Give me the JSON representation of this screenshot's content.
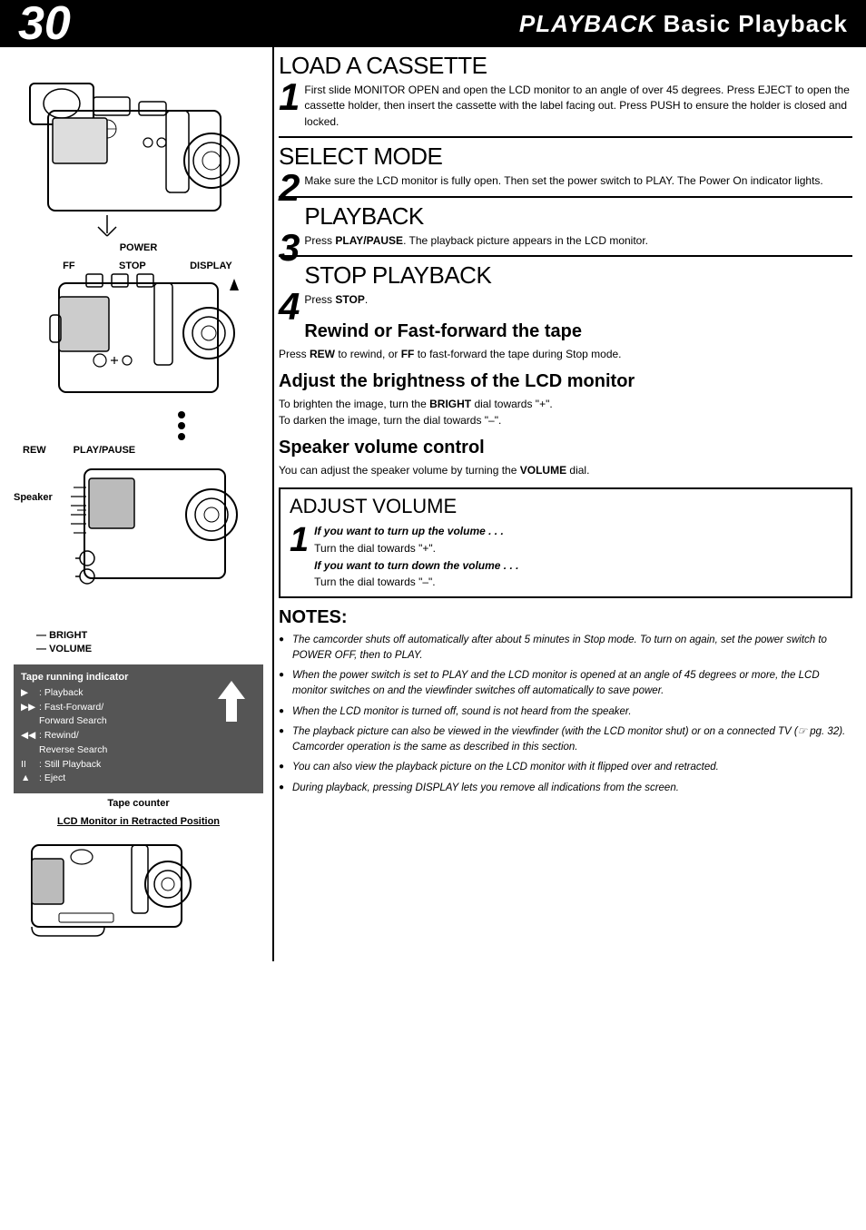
{
  "header": {
    "page_number": "30",
    "title_italic": "PLAYBACK",
    "title_normal": " Basic Playback"
  },
  "left": {
    "power_label": "POWER",
    "ff_label": "FF",
    "stop_label": "STOP",
    "display_label": "DISPLAY",
    "rew_label": "REW",
    "play_pause_label": "PLAY/PAUSE",
    "speaker_label": "Speaker",
    "bright_label": "BRIGHT",
    "volume_label": "VOLUME",
    "tape_indicator": {
      "title": "Tape running indicator",
      "rows": [
        {
          "symbol": "▶",
          "desc": ": Playback"
        },
        {
          "symbol": "▶▶",
          "desc": ": Fast-Forward/ Forward Search"
        },
        {
          "symbol": "◀◀",
          "desc": ": Rewind/ Reverse Search"
        },
        {
          "symbol": "II",
          "desc": ": Still Playback"
        },
        {
          "symbol": "▲",
          "desc": ": Eject"
        }
      ]
    },
    "tape_counter": "Tape counter",
    "lcd_label": "LCD Monitor in Retracted Position"
  },
  "right": {
    "section1": {
      "header": "LOAD A CASSETTE",
      "number": "1",
      "text": "First slide MONITOR OPEN and open the LCD monitor to an angle of over 45 degrees. Press EJECT to open the cassette holder, then insert the cassette with the label facing out. Press PUSH to ensure the holder is closed and locked."
    },
    "section2": {
      "header": "SELECT MODE",
      "number": "2",
      "text": "Make sure the LCD monitor is fully open. Then set the power switch to PLAY. The Power On indicator lights."
    },
    "section3": {
      "header": "PLAYBACK",
      "number": "3",
      "text_before": "Press ",
      "bold": "PLAY/PAUSE",
      "text_after": ". The playback picture appears in the LCD monitor."
    },
    "section4": {
      "header": "STOP PLAYBACK",
      "number": "4",
      "text_before": "Press ",
      "bold": "STOP",
      "text_after": "."
    },
    "rewind_heading": "Rewind or Fast-forward the tape",
    "rewind_text_before": "Press ",
    "rewind_bold1": "REW",
    "rewind_text_mid": " to rewind, or ",
    "rewind_bold2": "FF",
    "rewind_text_after": " to fast-forward the tape during Stop mode.",
    "brightness_heading": "Adjust the brightness of the LCD monitor",
    "brightness_text_before": "To brighten the image, turn the ",
    "brightness_bold1": "BRIGHT",
    "brightness_text_mid": " dial towards \"+\".\nTo darken the image, turn the dial towards \"",
    "brightness_dash": "–",
    "brightness_text_end": "\".",
    "speaker_heading": "Speaker volume control",
    "speaker_text_before": "You can adjust the speaker volume by turning the ",
    "speaker_bold": "VOLUME",
    "speaker_text_after": " dial.",
    "adjust": {
      "header": "ADJUST VOLUME",
      "number": "1",
      "line1_italic": "If you want to turn up the volume . . .",
      "line1_text": "Turn the dial towards \"+\".",
      "line2_italic": "If you want to turn down the volume . . .",
      "line2_text": "Turn the dial towards \"–\"."
    },
    "notes_heading": "NOTES:",
    "notes": [
      "The camcorder shuts off automatically after about 5 minutes in Stop mode. To turn on again, set the power switch to POWER OFF, then to PLAY.",
      "When the power switch is set to PLAY and the LCD monitor is opened at an angle of 45 degrees or more, the LCD monitor switches on and the viewfinder switches off automatically to save power.",
      "When the LCD monitor is turned off, sound is not heard from the speaker.",
      "The playback picture can also be viewed in the viewfinder (with the LCD monitor shut) or on a connected TV (☞ pg. 32). Camcorder operation is the same as described in this section.",
      "You can also view the playback picture on the LCD monitor with it flipped over and retracted.",
      "During playback, pressing DISPLAY lets you remove all indications from the screen."
    ]
  }
}
